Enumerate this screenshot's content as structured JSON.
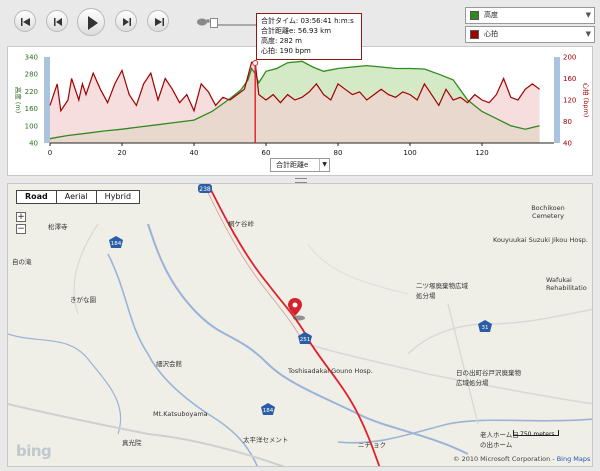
{
  "controls": {
    "rewind": "rewind-icon",
    "step_back": "step-back-icon",
    "play": "play-icon",
    "step_forward": "step-forward-icon",
    "fast_forward": "fast-forward-icon",
    "slow": "turtle-icon",
    "fast": "rabbit-icon"
  },
  "legend": {
    "top": {
      "label": "高度",
      "color": "#2e8b1e"
    },
    "bottom": {
      "label": "心拍",
      "color": "#a00000"
    }
  },
  "tooltip": {
    "line1": "合計タイム: 03:56:41 h:m:s",
    "line2": "合計距離e: 56.93 km",
    "line3": "高度: 282 m",
    "line4": "心拍: 190 bpm"
  },
  "x_selector": "合計距離e",
  "chart_data": {
    "type": "area",
    "xlabel": "",
    "xlim": [
      0,
      140
    ],
    "x_ticks": [
      "0",
      "20",
      "40",
      "60",
      "80",
      "100",
      "120"
    ],
    "y_left": {
      "label": "高度 (m)",
      "ticks": [
        "40",
        "100",
        "160",
        "220",
        "280",
        "340"
      ],
      "range": [
        40,
        340
      ]
    },
    "y_right": {
      "label": "心拍 (bpm)",
      "ticks": [
        "40",
        "80",
        "120",
        "160",
        "200"
      ],
      "range": [
        40,
        200
      ]
    },
    "cursor_x": 57,
    "series": [
      {
        "name": "高度",
        "axis": "left",
        "color": "#2e8b1e",
        "fill": "#cfe8c0",
        "x": [
          0,
          2,
          5,
          10,
          15,
          20,
          25,
          30,
          35,
          40,
          45,
          50,
          53,
          55,
          56,
          57,
          58,
          60,
          63,
          66,
          70,
          73,
          76,
          80,
          84,
          88,
          92,
          96,
          100,
          104,
          108,
          112,
          116,
          120,
          124,
          128,
          132,
          136
        ],
        "y": [
          55,
          60,
          66,
          74,
          82,
          88,
          96,
          104,
          112,
          120,
          150,
          195,
          225,
          260,
          300,
          282,
          250,
          290,
          300,
          320,
          325,
          305,
          290,
          300,
          305,
          310,
          305,
          300,
          300,
          298,
          280,
          260,
          190,
          150,
          125,
          100,
          88,
          100
        ]
      },
      {
        "name": "心拍",
        "axis": "right",
        "color": "#a00000",
        "fill": "#f2d0d0",
        "x": [
          0,
          2,
          3,
          5,
          6,
          8,
          9,
          10,
          12,
          14,
          16,
          18,
          20,
          22,
          24,
          26,
          28,
          30,
          32,
          34,
          36,
          38,
          40,
          42,
          44,
          46,
          48,
          50,
          52,
          54,
          56,
          57,
          58,
          60,
          62,
          64,
          66,
          68,
          70,
          72,
          74,
          76,
          78,
          80,
          82,
          84,
          86,
          88,
          90,
          92,
          94,
          96,
          98,
          100,
          102,
          104,
          106,
          108,
          110,
          112,
          114,
          116,
          118,
          120,
          122,
          124,
          126,
          128,
          130,
          132,
          134,
          136
        ],
        "y": [
          110,
          150,
          100,
          120,
          160,
          120,
          150,
          130,
          170,
          140,
          115,
          150,
          175,
          130,
          110,
          150,
          170,
          120,
          160,
          140,
          115,
          130,
          100,
          150,
          135,
          110,
          125,
          120,
          130,
          140,
          190,
          190,
          130,
          120,
          130,
          115,
          130,
          120,
          125,
          135,
          150,
          130,
          120,
          150,
          140,
          130,
          135,
          120,
          130,
          140,
          130,
          125,
          135,
          130,
          120,
          150,
          130,
          110,
          140,
          120,
          125,
          115,
          130,
          120,
          115,
          130,
          160,
          125,
          120,
          140,
          150,
          140
        ]
      }
    ]
  },
  "map": {
    "types": [
      "Road",
      "Aerial",
      "Hybrid"
    ],
    "selected_type": "Road",
    "zoom_in": "+",
    "zoom_out": "−",
    "labels": {
      "l1": "松澤寺",
      "l2": "自の滝",
      "l3": "きがな園",
      "l4": "細沢会館",
      "l5": "Mt.Katsuboyama",
      "l6": "真光院",
      "l7": "太平洋セメント",
      "l8": "桐ケ谷峠",
      "l9": "Toshisadakai Gouno Hosp.",
      "l10": "二ツ塚廃棄物広域処分場",
      "l11": "日の出町谷戸沢廃棄物広域処分場",
      "l12": "Bochikoen Cemetery",
      "l13": "Kouyuukai Suzuki Jikou Hosp.",
      "l14": "Wafukai Rehabilitatio",
      "l15": "老人ホーム日の出ホーム",
      "l16": "ニチ ョク"
    },
    "road_shields": [
      "238",
      "184",
      "31",
      "184",
      "251"
    ],
    "scale_label": "750 meters",
    "copyright": "© 2010 Microsoft Corporation - ",
    "copyright_link": "Bing Maps",
    "logo": "bing"
  }
}
